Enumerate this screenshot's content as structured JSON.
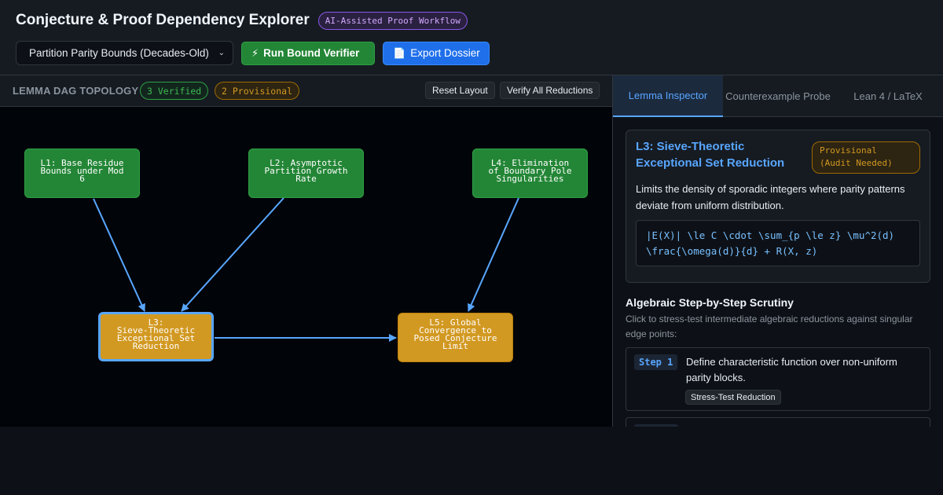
{
  "header": {
    "title": "Conjecture & Proof Dependency Explorer",
    "badge": "AI-Assisted Proof Workflow",
    "select_value": "Partition Parity Bounds (Decades-Old)",
    "run_button": "Run Bound Verifier",
    "export_button": "Export Dossier",
    "run_icon": "lightning-icon",
    "export_icon": "document-icon"
  },
  "dag": {
    "title": "LEMMA DAG TOPOLOGY",
    "verified_pill": "3 Verified",
    "provisional_pill": "2 Provisional",
    "reset_button": "Reset Layout",
    "verify_button": "Verify All Reductions",
    "nodes": [
      {
        "id": "L1",
        "label": "L1: Base Residue\nBounds under Mod\n6",
        "status": "verified"
      },
      {
        "id": "L2",
        "label": "L2: Asymptotic\nPartition Growth\nRate",
        "status": "verified"
      },
      {
        "id": "L4",
        "label": "L4: Elimination\nof Boundary Pole\nSingularities",
        "status": "verified"
      },
      {
        "id": "L3",
        "label": "L3:\nSieve-Theoretic\nExceptional Set\nReduction",
        "status": "provisional",
        "selected": true
      },
      {
        "id": "L5",
        "label": "L5: Global\nConvergence to\nPosed Conjecture\nLimit",
        "status": "provisional"
      }
    ],
    "edges": [
      [
        "L1",
        "L3"
      ],
      [
        "L2",
        "L3"
      ],
      [
        "L4",
        "L5"
      ],
      [
        "L3",
        "L5"
      ]
    ],
    "colors": {
      "verified": "#238636",
      "provisional": "#d29922",
      "edge": "#58a6ff"
    }
  },
  "inspector": {
    "tabs": [
      "Lemma Inspector",
      "Counterexample Probe",
      "Lean 4 / LaTeX"
    ],
    "active_tab": "Lemma Inspector",
    "lemma_title": "L3: Sieve-Theoretic Exceptional Set Reduction",
    "status": "Provisional (Audit Needed)",
    "description": "Limits the density of sporadic integers where parity patterns deviate from uniform distribution.",
    "formula": "|E(X)| \\le C \\cdot \\sum_{p \\le z} \\mu^2(d) \\frac{\\omega(d)}{d} + R(X, z)",
    "scrutiny_title": "Algebraic Step-by-Step Scrutiny",
    "scrutiny_sub": "Click to stress-test intermediate algebraic reductions against singular edge points:",
    "steps": [
      {
        "tag": "Step 1",
        "text": "Define characteristic function over non-uniform parity blocks.",
        "button": "Stress-Test Reduction"
      }
    ]
  }
}
